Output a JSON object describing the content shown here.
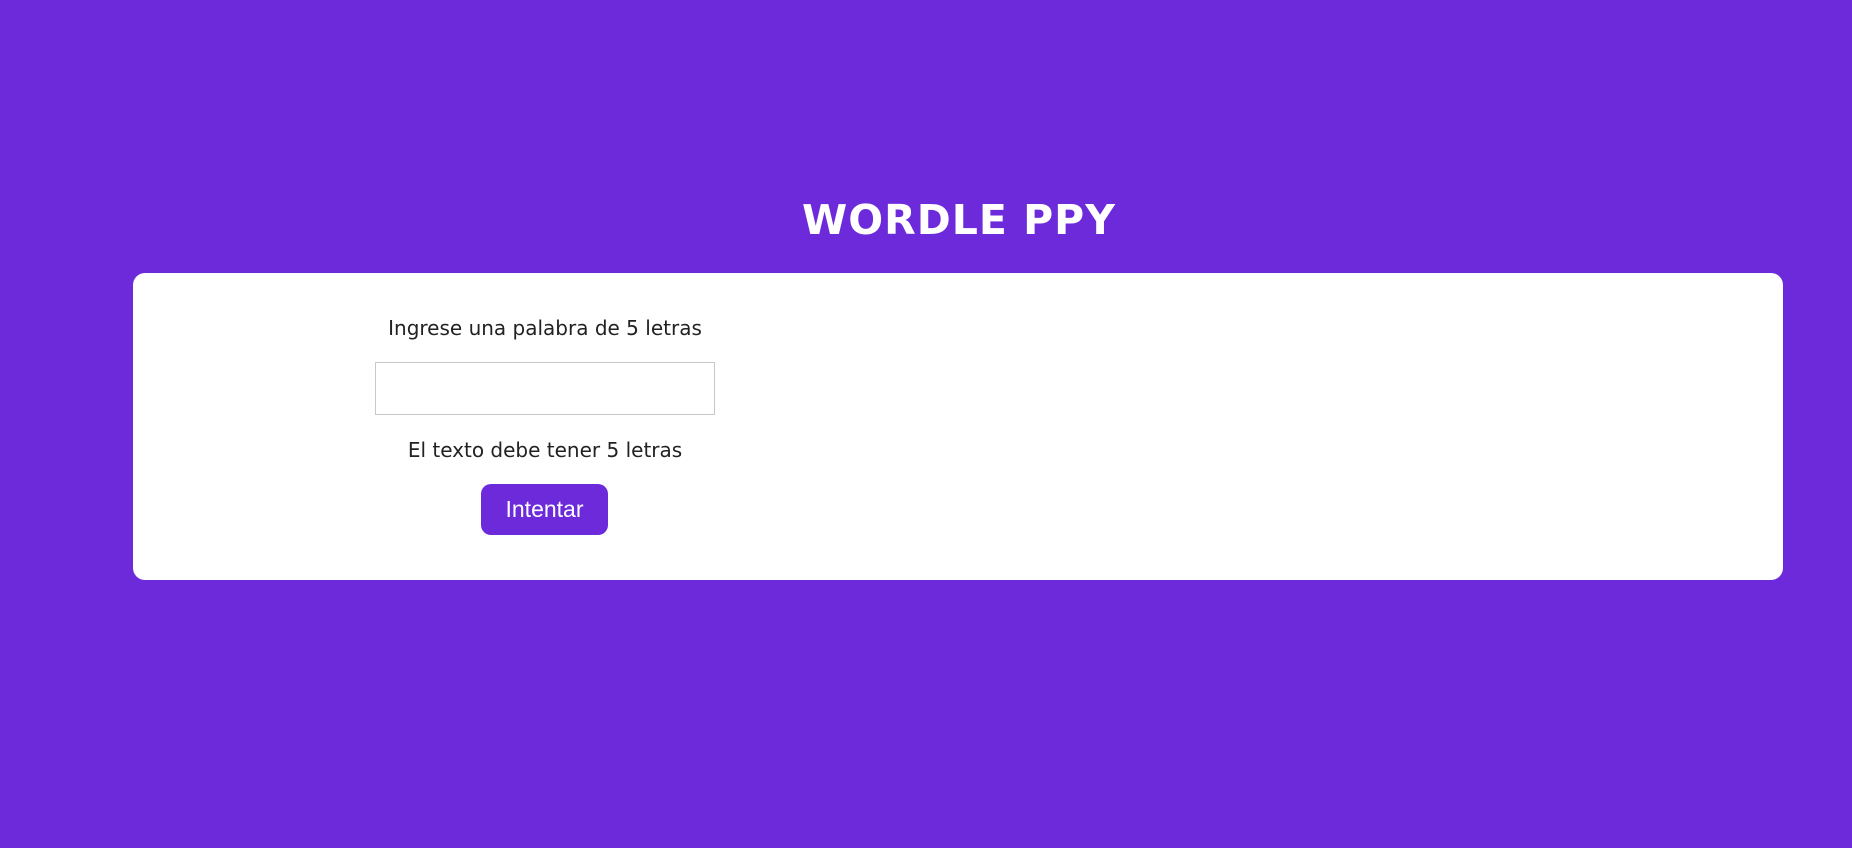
{
  "header": {
    "title": "WORDLE PPY"
  },
  "form": {
    "prompt_label": "Ingrese una palabra de 5 letras",
    "input_value": "",
    "hint_text": "El texto debe tener 5 letras",
    "submit_label": "Intentar"
  },
  "colors": {
    "background": "#6c2adb",
    "card": "#ffffff",
    "accent": "#6c2adb"
  }
}
